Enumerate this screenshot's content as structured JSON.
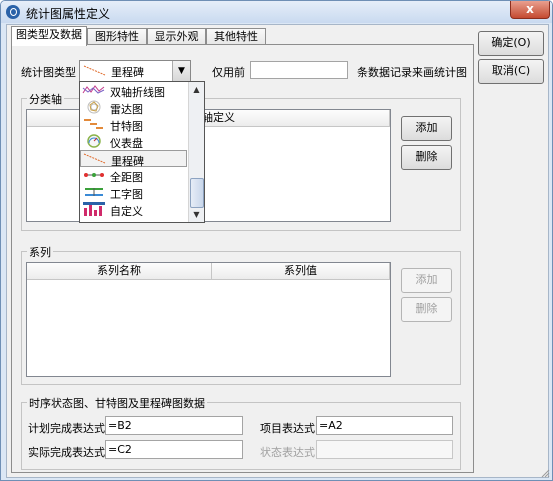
{
  "window": {
    "title": "统计图属性定义",
    "close_glyph": "x"
  },
  "tabs": [
    {
      "label": "图类型及数据",
      "active": true
    },
    {
      "label": "图形特性",
      "active": false
    },
    {
      "label": "显示外观",
      "active": false
    },
    {
      "label": "其他特性",
      "active": false
    }
  ],
  "buttons": {
    "ok": "确定(O)",
    "cancel": "取消(C)"
  },
  "chart_type": {
    "label": "统计图类型",
    "selected": "里程碑",
    "options": [
      {
        "label": "双轴折线图",
        "icon": "dual-axis-line-icon"
      },
      {
        "label": "雷达图",
        "icon": "radar-icon"
      },
      {
        "label": "甘特图",
        "icon": "gantt-icon"
      },
      {
        "label": "仪表盘",
        "icon": "gauge-icon"
      },
      {
        "label": "里程碑",
        "icon": "milestone-icon"
      },
      {
        "label": "全距图",
        "icon": "range-icon"
      },
      {
        "label": "工字图",
        "icon": "i-beam-icon"
      },
      {
        "label": "自定义",
        "icon": "custom-icon"
      }
    ]
  },
  "only_before": {
    "label": "仅用前",
    "value": "",
    "suffix": "条数据记录来画统计图"
  },
  "category_axis": {
    "title": "分类轴",
    "column": "轴定义",
    "add": "添加",
    "delete": "删除"
  },
  "series": {
    "title": "系列",
    "columns": [
      "系列名称",
      "系列值"
    ],
    "add": "添加",
    "delete": "删除"
  },
  "timing": {
    "title": "时序状态图、甘特图及里程碑图数据",
    "plan_label": "计划完成表达式",
    "plan_value": "=B2",
    "item_label": "项目表达式",
    "item_value": "=A2",
    "actual_label": "实际完成表达式",
    "actual_value": "=C2",
    "status_label": "状态表达式",
    "status_value": ""
  }
}
